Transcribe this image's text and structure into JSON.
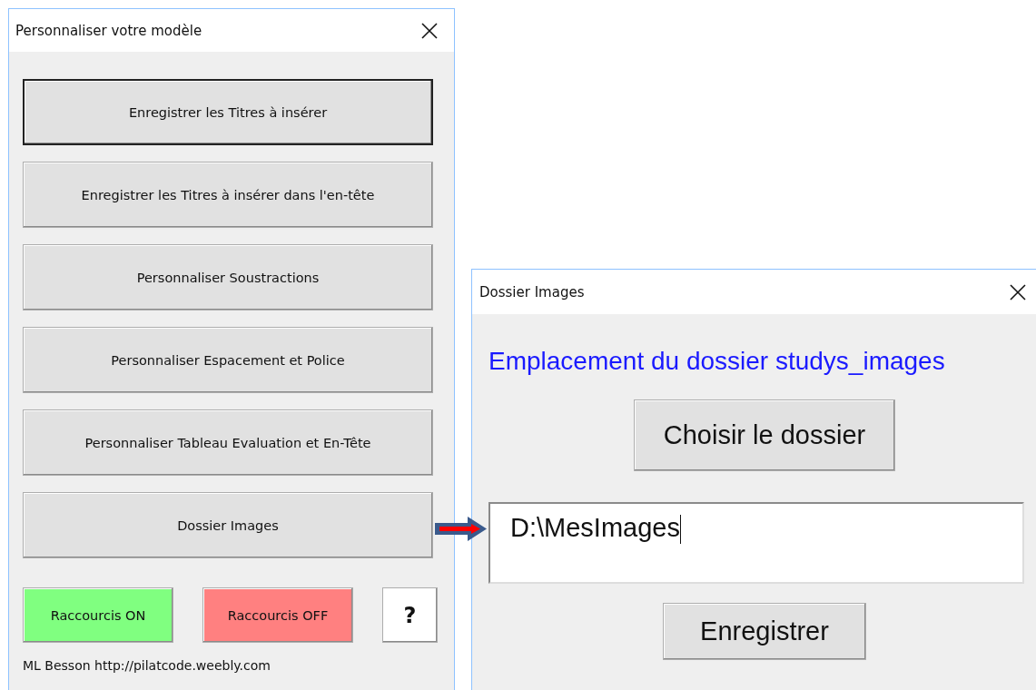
{
  "main_window": {
    "title": "Personnaliser votre modèle",
    "buttons": [
      {
        "label": "Enregistrer les Titres à insérer",
        "default": true
      },
      {
        "label": "Enregistrer les Titres à insérer dans l'en-tête",
        "default": false
      },
      {
        "label": "Personnaliser Soustractions",
        "default": false
      },
      {
        "label": "Personnaliser Espacement et Police",
        "default": false
      },
      {
        "label": "Personnaliser Tableau Evaluation et En-Tête",
        "default": false
      },
      {
        "label": "Dossier Images",
        "default": false
      }
    ],
    "shortcut_buttons": [
      {
        "label": "Raccourcis ON",
        "color": "#80ff80"
      },
      {
        "label": "Raccourcis OFF",
        "color": "#ff8080"
      }
    ],
    "help_button": "?",
    "footer": "ML Besson http://pilatcode.weebly.com"
  },
  "dialog": {
    "title": "Dossier Images",
    "heading": "Emplacement du dossier studys_images",
    "choose_button": "Choisir le dossier",
    "path_field": {
      "value": "D:\\MesImages",
      "focused": true
    },
    "save_button": "Enregistrer"
  }
}
